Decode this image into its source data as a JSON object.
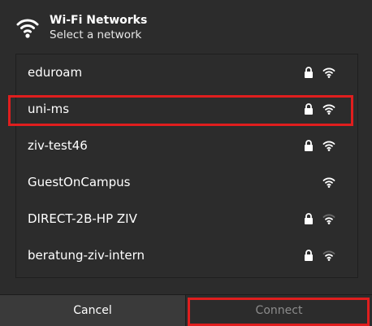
{
  "dialog": {
    "title": "Wi-Fi Networks",
    "subtitle": "Select a network",
    "icon": "wifi-icon"
  },
  "networks": [
    {
      "ssid": "eduroam",
      "secured": true,
      "signal": "strong",
      "selected": false
    },
    {
      "ssid": "uni-ms",
      "secured": true,
      "signal": "strong",
      "selected": true
    },
    {
      "ssid": "ziv-test46",
      "secured": true,
      "signal": "strong",
      "selected": false
    },
    {
      "ssid": "GuestOnCampus",
      "secured": false,
      "signal": "strong",
      "selected": false
    },
    {
      "ssid": "DIRECT-2B-HP ZIV",
      "secured": true,
      "signal": "medium",
      "selected": false
    },
    {
      "ssid": "beratung-ziv-intern",
      "secured": true,
      "signal": "medium",
      "selected": false
    }
  ],
  "buttons": {
    "cancel_label": "Cancel",
    "connect_label": "Connect"
  },
  "colors": {
    "background": "#2c2c2c",
    "highlight": "#e01e1e",
    "disabled_text": "#8c8c8c"
  }
}
